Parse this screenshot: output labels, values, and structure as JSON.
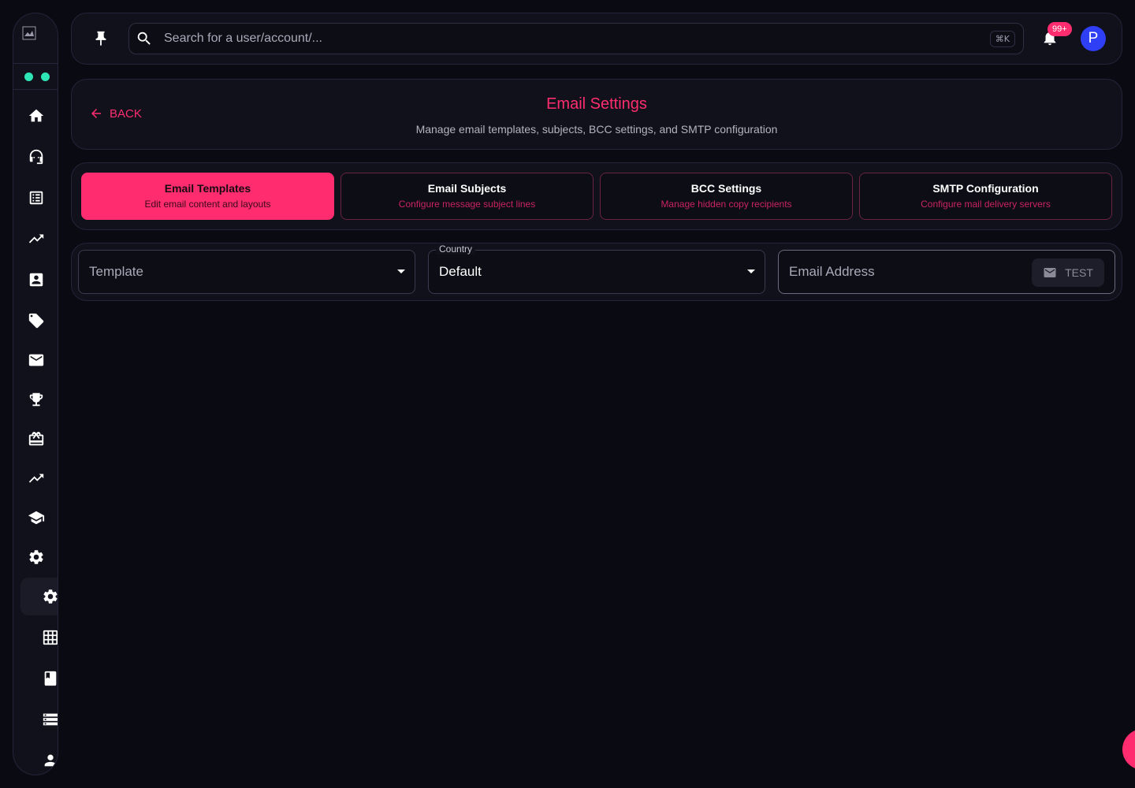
{
  "sidebar": {
    "items": [
      {
        "icon": "home-icon"
      },
      {
        "icon": "support-agent-icon"
      },
      {
        "icon": "list-icon"
      },
      {
        "icon": "trending-up-icon"
      },
      {
        "icon": "contact-card-icon"
      },
      {
        "icon": "tag-icon"
      },
      {
        "icon": "mail-icon"
      },
      {
        "icon": "trophy-icon"
      },
      {
        "icon": "gift-card-icon"
      },
      {
        "icon": "trending-up-icon"
      },
      {
        "icon": "school-icon"
      },
      {
        "icon": "settings-icon"
      },
      {
        "icon": "settings-icon",
        "active": true
      },
      {
        "icon": "grid-icon"
      },
      {
        "icon": "book-icon"
      },
      {
        "icon": "storage-icon"
      },
      {
        "icon": "person-icon"
      }
    ],
    "status_dot_color": "#2ee5b6"
  },
  "topbar": {
    "search_placeholder": "Search for a user/account/...",
    "shortcut": "⌘K",
    "notification_badge": "99+",
    "avatar_letter": "P"
  },
  "header": {
    "back_label": "BACK",
    "title": "Email Settings",
    "subtitle": "Manage email templates, subjects, BCC settings, and SMTP configuration"
  },
  "tabs": [
    {
      "title": "Email Templates",
      "description": "Edit email content and layouts",
      "active": true
    },
    {
      "title": "Email Subjects",
      "description": "Configure message subject lines",
      "active": false
    },
    {
      "title": "BCC Settings",
      "description": "Manage hidden copy recipients",
      "active": false
    },
    {
      "title": "SMTP Configuration",
      "description": "Configure mail delivery servers",
      "active": false
    }
  ],
  "filters": {
    "template_placeholder": "Template",
    "country_label": "Country",
    "country_value": "Default",
    "email_placeholder": "Email Address",
    "test_button_label": "TEST"
  },
  "colors": {
    "accent": "#ff2d6f",
    "background": "#0a0a12",
    "card": "#11111b",
    "avatar": "#2f3ff5"
  }
}
